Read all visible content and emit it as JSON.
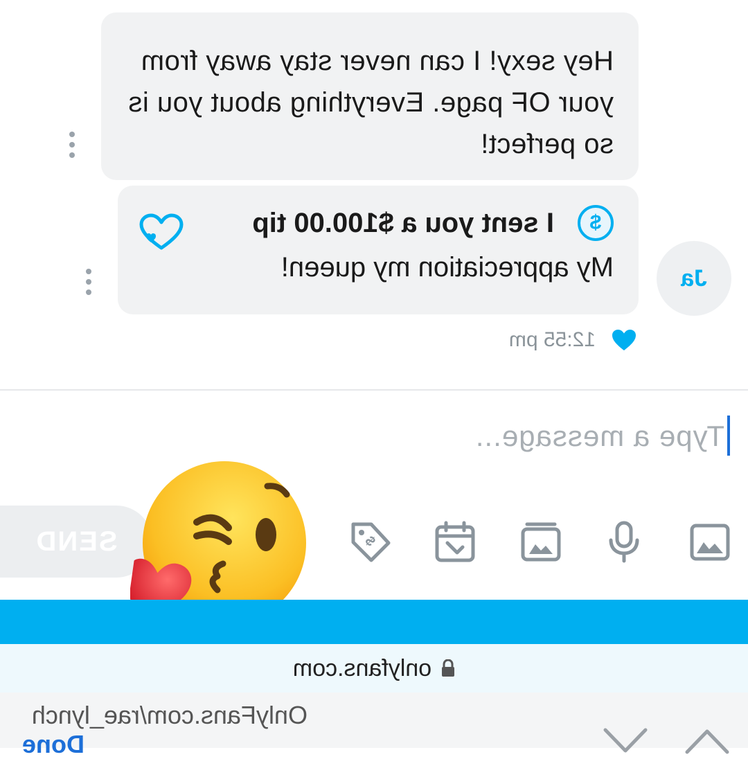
{
  "messages": {
    "first": {
      "text": "Hey sexy! I can never stay away from your OF page. Everything about you is so perfect!"
    },
    "tip": {
      "icon": "dollar-icon",
      "tip_text": "I sent you a $100.00 tip",
      "message": "My appreciation my queen!",
      "reaction_icon": "heart-outline-icon"
    }
  },
  "avatar": {
    "initials": "Ja"
  },
  "meta": {
    "time": "12:55 pm",
    "liked_icon": "heart-filled-icon"
  },
  "compose": {
    "placeholder": "Type a message..."
  },
  "toolbar": {
    "icons": [
      "image-icon",
      "microphone-icon",
      "vault-icon",
      "calendar-icon",
      "price-tag-icon"
    ],
    "send_label": "SEND"
  },
  "sticker": {
    "icon": "kissing-face-heart-emoji"
  },
  "browser": {
    "domain": "onlyfans.com",
    "full_url": "OnlyFans.com/rae_lynch",
    "done_label": "Done",
    "nav_icons": [
      "chevron-up-icon",
      "chevron-down-icon"
    ]
  },
  "colors": {
    "accent": "#00aff0",
    "bubble": "#f1f2f3",
    "text": "#1a1a1a",
    "muted": "#8a9399",
    "link": "#1d6fd8"
  }
}
